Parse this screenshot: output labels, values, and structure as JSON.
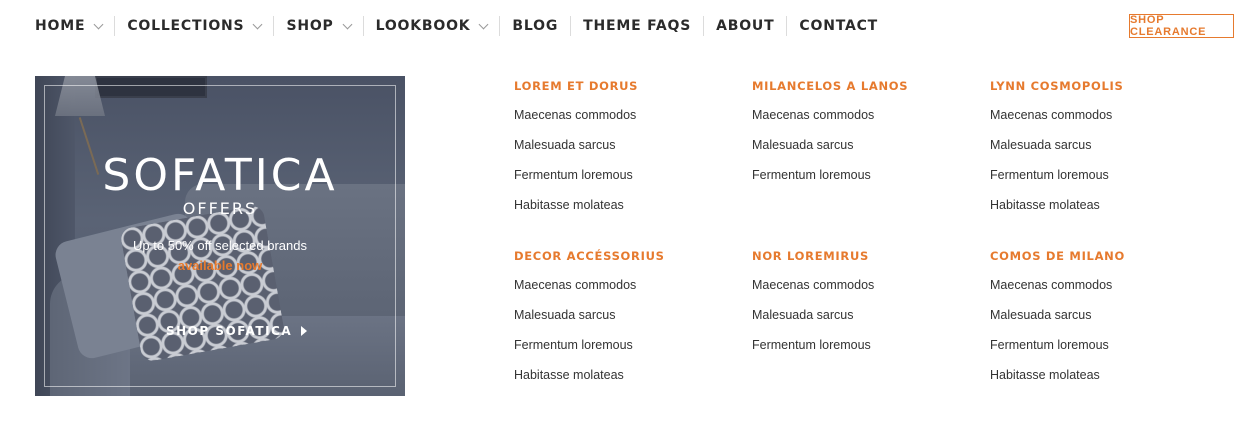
{
  "nav": {
    "items": [
      {
        "label": "HOME",
        "dropdown": true
      },
      {
        "label": "COLLECTIONS",
        "dropdown": true
      },
      {
        "label": "SHOP",
        "dropdown": true
      },
      {
        "label": "LOOKBOOK",
        "dropdown": true
      },
      {
        "label": "BLOG",
        "dropdown": false
      },
      {
        "label": "THEME FAQS",
        "dropdown": false
      },
      {
        "label": "ABOUT",
        "dropdown": false
      },
      {
        "label": "CONTACT",
        "dropdown": false
      }
    ],
    "clearance_label": "SHOP CLEARANCE"
  },
  "promo": {
    "title": "SOFATICA",
    "subtitle": "OFFERS",
    "description": "Up to 50% off selected brands",
    "highlight": "available now",
    "cta": "SHOP SOFATICA",
    "cta_icon": "caret-right-icon"
  },
  "menu": {
    "columns": [
      {
        "heading": "LOREM ET DORUS",
        "links": [
          "Maecenas commodos",
          "Malesuada sarcus",
          "Fermentum loremous",
          "Habitasse molateas"
        ]
      },
      {
        "heading": "MILANCELOS A LANOS",
        "links": [
          "Maecenas commodos",
          "Malesuada sarcus",
          "Fermentum loremous"
        ]
      },
      {
        "heading": "LYNN COSMOPOLIS",
        "links": [
          "Maecenas commodos",
          "Malesuada sarcus",
          "Fermentum loremous",
          "Habitasse molateas"
        ]
      },
      {
        "heading": "DECOR ACCÉSSORIUS",
        "links": [
          "Maecenas commodos",
          "Malesuada sarcus",
          "Fermentum loremous",
          "Habitasse molateas"
        ]
      },
      {
        "heading": "NOR LOREMIRUS",
        "links": [
          "Maecenas commodos",
          "Malesuada sarcus",
          "Fermentum loremous"
        ]
      },
      {
        "heading": "COMOS DE MILANO",
        "links": [
          "Maecenas commodos",
          "Malesuada sarcus",
          "Fermentum loremous",
          "Habitasse molateas"
        ]
      }
    ]
  },
  "colors": {
    "accent": "#e67a2e",
    "nav_text": "#2b2b2b",
    "link_text": "#333333",
    "promo_bg": "#525b6d"
  }
}
